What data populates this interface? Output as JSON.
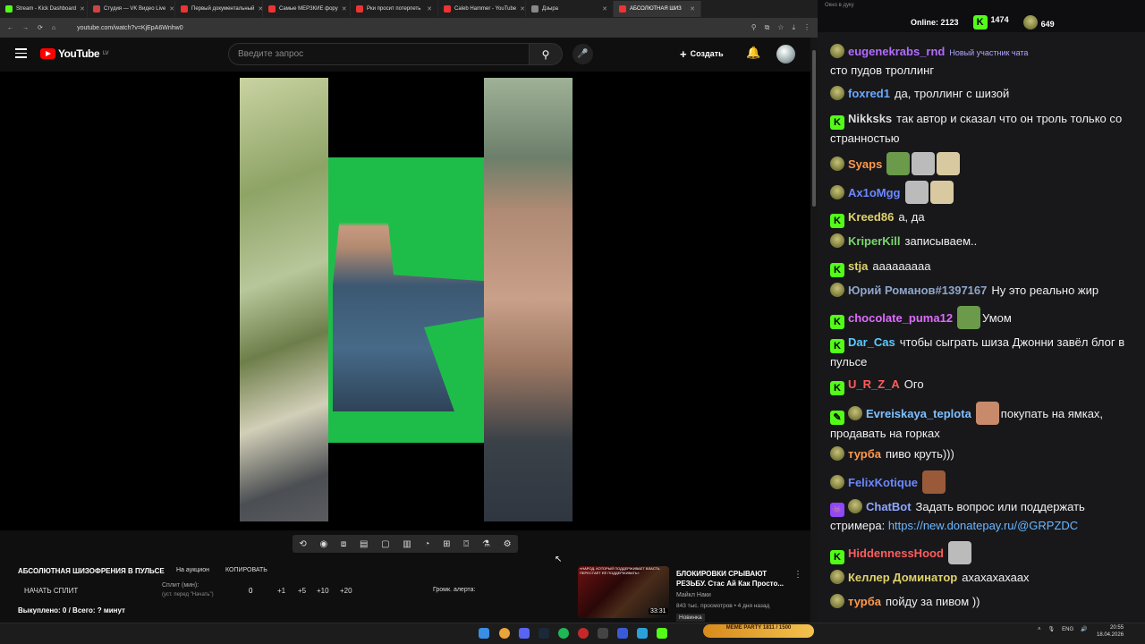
{
  "browser": {
    "tabs": [
      {
        "label": "Stream - Kick Dashboard",
        "color": "#53fc18"
      },
      {
        "label": "Студия — VK Видео Live",
        "color": "#c44"
      },
      {
        "label": "Первый документальный",
        "color": "#e33"
      },
      {
        "label": "Самые МЕРЗКИЕ фору",
        "color": "#e33"
      },
      {
        "label": "Рки просит потерпеть",
        "color": "#e33"
      },
      {
        "label": "Caleb Hammer - YouTube",
        "color": "#e33"
      },
      {
        "label": "Дзыра",
        "color": "#888"
      },
      {
        "label": "АБСОЛЮТНАЯ ШИЗ",
        "color": "#e33"
      }
    ],
    "url": "youtube.com/watch?v=KjEpA6Wnhw0"
  },
  "youtube": {
    "logo": "YouTube",
    "region": "LV",
    "search_placeholder": "Введите запрос",
    "create_label": "Создать"
  },
  "video_panel": {
    "title": "АБСОЛЮТНАЯ ШИЗОФРЕНИЯ В ПУЛЬСЕ",
    "auction": "На аукцион",
    "copy": "КОПИРОВАТЬ",
    "split_button": "НАЧАТЬ СПЛИТ",
    "split_min": "Сплит (мин):",
    "split_hint": "(уст. перед \"Начать\")",
    "split_value": "0",
    "increments": [
      "+1",
      "+5",
      "+10",
      "+20"
    ],
    "alert_volume": "Громк. алерта:",
    "bought": "Выкуплено: 0 / Всего: ? минут"
  },
  "recommended": {
    "thumb_text": "«НАРОД, КОТОРЫЙ ПОДДЕРЖИВАЕТ ВЛАСТЬ ПЕРЕСТАЁТ ЕЁ ПОДДЕРЖИВАТЬ»",
    "duration": "33:31",
    "title": "БЛОКИРОВКИ СРЫВАЮТ РЕЗЬБУ. Стас Ай Как Просто...",
    "channel": "Майкл Наки",
    "meta": "843 тыс. просмотров • 4 дня назад",
    "badge": "Новинка"
  },
  "chat": {
    "window_title": "Окно в дуку",
    "online_label": "Online:",
    "online_count": "2123",
    "kick_count": "1474",
    "other_count": "649",
    "messages": [
      {
        "user": "eugenekrabs_rnd",
        "tag": "Новый участник чата",
        "text": "сто пудов троллинг",
        "color": "#b46bff"
      },
      {
        "user": "foxred1",
        "text": "да, троллинг с шизой",
        "color": "#6aa9ff"
      },
      {
        "user": "Nikksks",
        "text": "так автор и сказал что он троль только со странностью",
        "color": "#dcdcdc"
      },
      {
        "user": "Syaps",
        "text": "",
        "color": "#ff9a4d"
      },
      {
        "user": "Ax1oMgg",
        "text": "",
        "color": "#6b88ff"
      },
      {
        "user": "Kreed86",
        "text": "а, да",
        "color": "#e0d36a"
      },
      {
        "user": "KriperKill",
        "text": "записываем..",
        "color": "#7bd66b"
      },
      {
        "user": "stja",
        "text": "ааааааааа",
        "color": "#e0d36a"
      },
      {
        "user": "Юрий Романов#1397167",
        "text": "Ну это реально жир",
        "color": "#8fa6c9"
      },
      {
        "user": "chocolate_puma12",
        "text": "Умом",
        "color": "#e06bff"
      },
      {
        "user": "Dar_Cas",
        "text": "чтобы сыграть шиза Джонни завёл блог в пульсе",
        "color": "#5cc9ff"
      },
      {
        "user": "U_R_Z_A",
        "text": "Ого",
        "color": "#ff5c5c"
      },
      {
        "user": "Evreiskaya_teplota",
        "text": "покупать на ямках, продавать на горках",
        "color": "#7ec0ff"
      },
      {
        "user": "турба",
        "text": "пиво круть)))",
        "color": "#ff9a4d"
      },
      {
        "user": "FelixKotique",
        "text": "",
        "color": "#6b88ff"
      },
      {
        "user": "ChatBot",
        "text": "Задать вопрос или поддержать стримера:",
        "link": "https://new.donatepay.ru/@GRPZDC",
        "color": "#8fa6ff"
      },
      {
        "user": "HiddennessHood",
        "text": "",
        "color": "#ff5c5c"
      },
      {
        "user": "Келлер Доминатор",
        "text": "ахахахахаах",
        "color": "#e0d36a"
      },
      {
        "user": "турба",
        "text": "пойду за пивом ))",
        "color": "#ff9a4d"
      }
    ]
  },
  "taskbar": {
    "meme_party": "MEME PARTY",
    "meme_count": "1811 / 1500",
    "lang": "ENG",
    "time": "20:55",
    "date": "18.04.2026"
  }
}
